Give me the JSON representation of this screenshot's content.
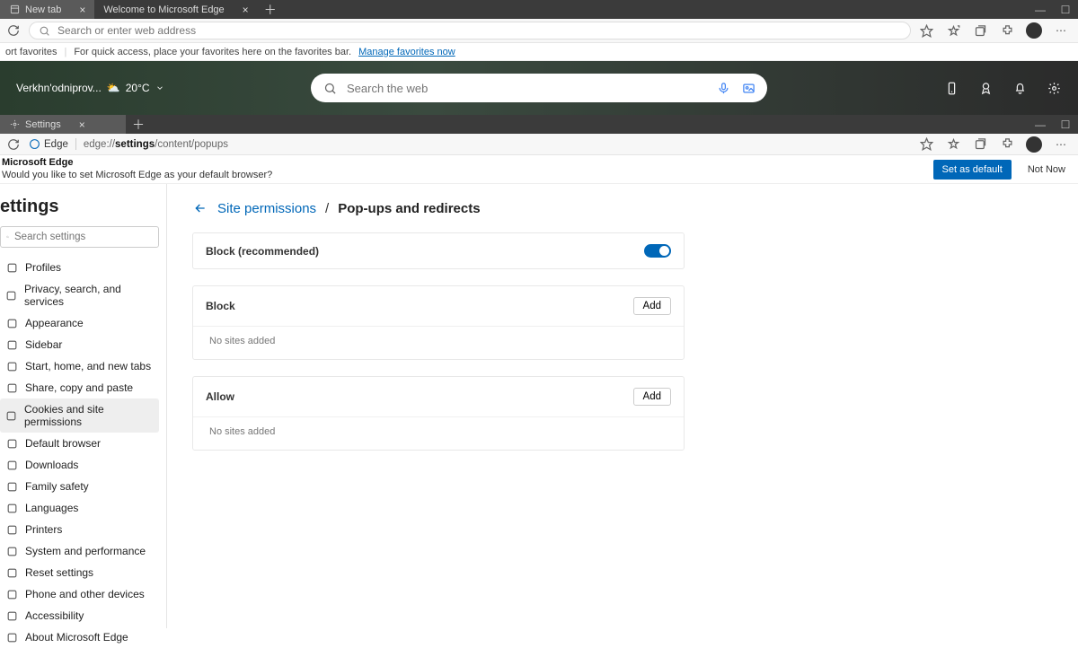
{
  "window1": {
    "tabs": [
      {
        "title": "New tab"
      },
      {
        "title": "Welcome to Microsoft Edge"
      }
    ],
    "address_placeholder": "Search or enter web address",
    "favbar_import": "ort favorites",
    "favbar_hint": "For quick access, place your favorites here on the favorites bar.",
    "favbar_link": "Manage favorites now"
  },
  "ntp": {
    "city": "Verkhn'odniprov...",
    "temp": "20°C",
    "search_placeholder": "Search the web"
  },
  "window2": {
    "tab_title": "Settings",
    "edge_label": "Edge",
    "url_prefix": "edge://",
    "url_bold": "settings",
    "url_suffix": "/content/popups",
    "infobar_title": "Microsoft Edge",
    "infobar_msg": "Would you like to set Microsoft Edge as your default browser?",
    "set_default": "Set as default",
    "not_now": "Not Now"
  },
  "sidebar": {
    "title": "ettings",
    "search_placeholder": "Search settings",
    "items": [
      "Profiles",
      "Privacy, search, and services",
      "Appearance",
      "Sidebar",
      "Start, home, and new tabs",
      "Share, copy and paste",
      "Cookies and site permissions",
      "Default browser",
      "Downloads",
      "Family safety",
      "Languages",
      "Printers",
      "System and performance",
      "Reset settings",
      "Phone and other devices",
      "Accessibility",
      "About Microsoft Edge"
    ],
    "active_index": 6
  },
  "page": {
    "bc_link": "Site permissions",
    "bc_current": "Pop-ups and redirects",
    "block_recommended": "Block (recommended)",
    "block_label": "Block",
    "allow_label": "Allow",
    "add_label": "Add",
    "no_sites": "No sites added"
  }
}
